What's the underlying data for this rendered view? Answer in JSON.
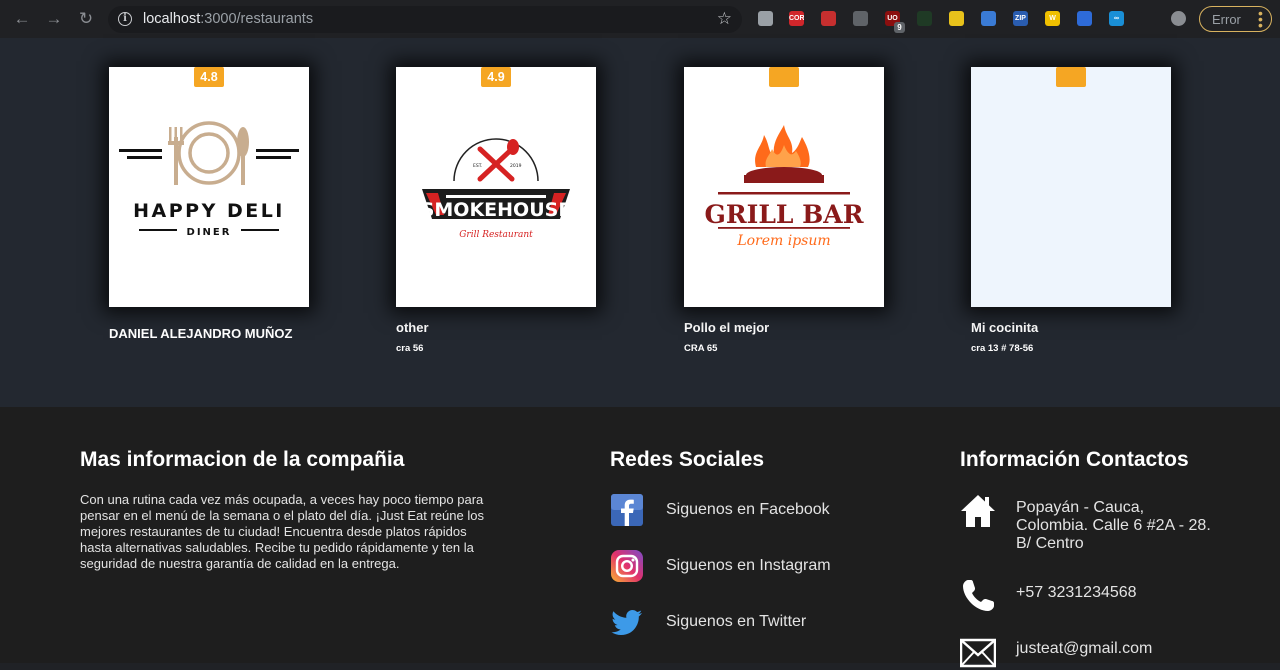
{
  "browser": {
    "url_host": "localhost",
    "url_path": ":3000/restaurants",
    "error_label": "Error",
    "extensions": [
      {
        "name": "vue-devtools-icon",
        "text": "",
        "color": "#9aa0a6"
      },
      {
        "name": "cors-extension-icon",
        "text": "CORS",
        "color": "#d0262b"
      },
      {
        "name": "tampermonkey-icon",
        "text": "",
        "color": "#c62f2f"
      },
      {
        "name": "record-target-icon",
        "text": "",
        "color": "#5f6368"
      },
      {
        "name": "ublock-icon",
        "text": "UO",
        "color": "#8b0f0f"
      },
      {
        "name": "screenshot-icon",
        "text": "",
        "color": "#1f3a25"
      },
      {
        "name": "ghost-icon",
        "text": "",
        "color": "#e8c21b"
      },
      {
        "name": "note-icon",
        "text": "",
        "color": "#3a7bd5"
      },
      {
        "name": "zip-icon",
        "text": "ZIP",
        "color": "#2a5db0"
      },
      {
        "name": "wappalyzer-icon",
        "text": "W",
        "color": "#f0c000"
      },
      {
        "name": "vpn-icon",
        "text": "",
        "color": "#2e6bd8"
      },
      {
        "name": "infinity-icon",
        "text": "∞",
        "color": "#1a8fd6"
      },
      {
        "name": "puzzle-extensions-icon",
        "text": "",
        "color": "#202124"
      },
      {
        "name": "profile-avatar-icon",
        "text": "",
        "color": "#8a8d92"
      }
    ],
    "ublock_count": "9"
  },
  "restaurants": [
    {
      "name": "DANIEL ALEJANDRO MUÑOZ",
      "address": "",
      "rating": "4.8",
      "logo": "happy-deli"
    },
    {
      "name": "other",
      "address": "cra 56",
      "rating": "4.9",
      "logo": "smokehouse"
    },
    {
      "name": "Pollo el mejor",
      "address": "CRA 65",
      "rating": "",
      "logo": "grill-bar"
    },
    {
      "name": "Mi cocinita",
      "address": "cra 13 # 78-56",
      "rating": "",
      "logo": "none"
    }
  ],
  "logos": {
    "happy_deli": {
      "title": "HAPPY DELI",
      "subtitle": "DINER"
    },
    "smokehouse": {
      "title": "SMOKEHOUSE",
      "subtitle": "Grill Restaurant",
      "est": "EST.",
      "year": "2019"
    },
    "grill_bar": {
      "title": "GRILL BAR",
      "subtitle": "Lorem ipsum"
    }
  },
  "footer": {
    "company": {
      "title": "Mas informacion de la compañia",
      "text": "Con una rutina cada vez más ocupada, a veces hay poco tiempo para pensar en el menú de la semana o el plato del día. ¡Just Eat reúne los mejores restaurantes de tu ciudad! Encuentra desde platos rápidos hasta alternativas saludables. Recibe tu pedido rápidamente y ten la seguridad de nuestra garantía de calidad en la entrega."
    },
    "social": {
      "title": "Redes Sociales",
      "items": [
        {
          "label": "Siguenos en Facebook",
          "icon": "facebook-icon"
        },
        {
          "label": "Siguenos en Instagram",
          "icon": "instagram-icon"
        },
        {
          "label": "Siguenos en Twitter",
          "icon": "twitter-icon"
        }
      ]
    },
    "contact": {
      "title": "Información Contactos",
      "address": "Popayán - Cauca, Colombia. Calle 6 #2A - 28. B/ Centro",
      "phone": "+57 3231234568",
      "email": "justeat@gmail.com"
    }
  },
  "colors": {
    "badge": "#f5a623",
    "section_bg": "#232830",
    "footer_bg": "#1e1e1e",
    "error_border": "#d8b25f"
  }
}
